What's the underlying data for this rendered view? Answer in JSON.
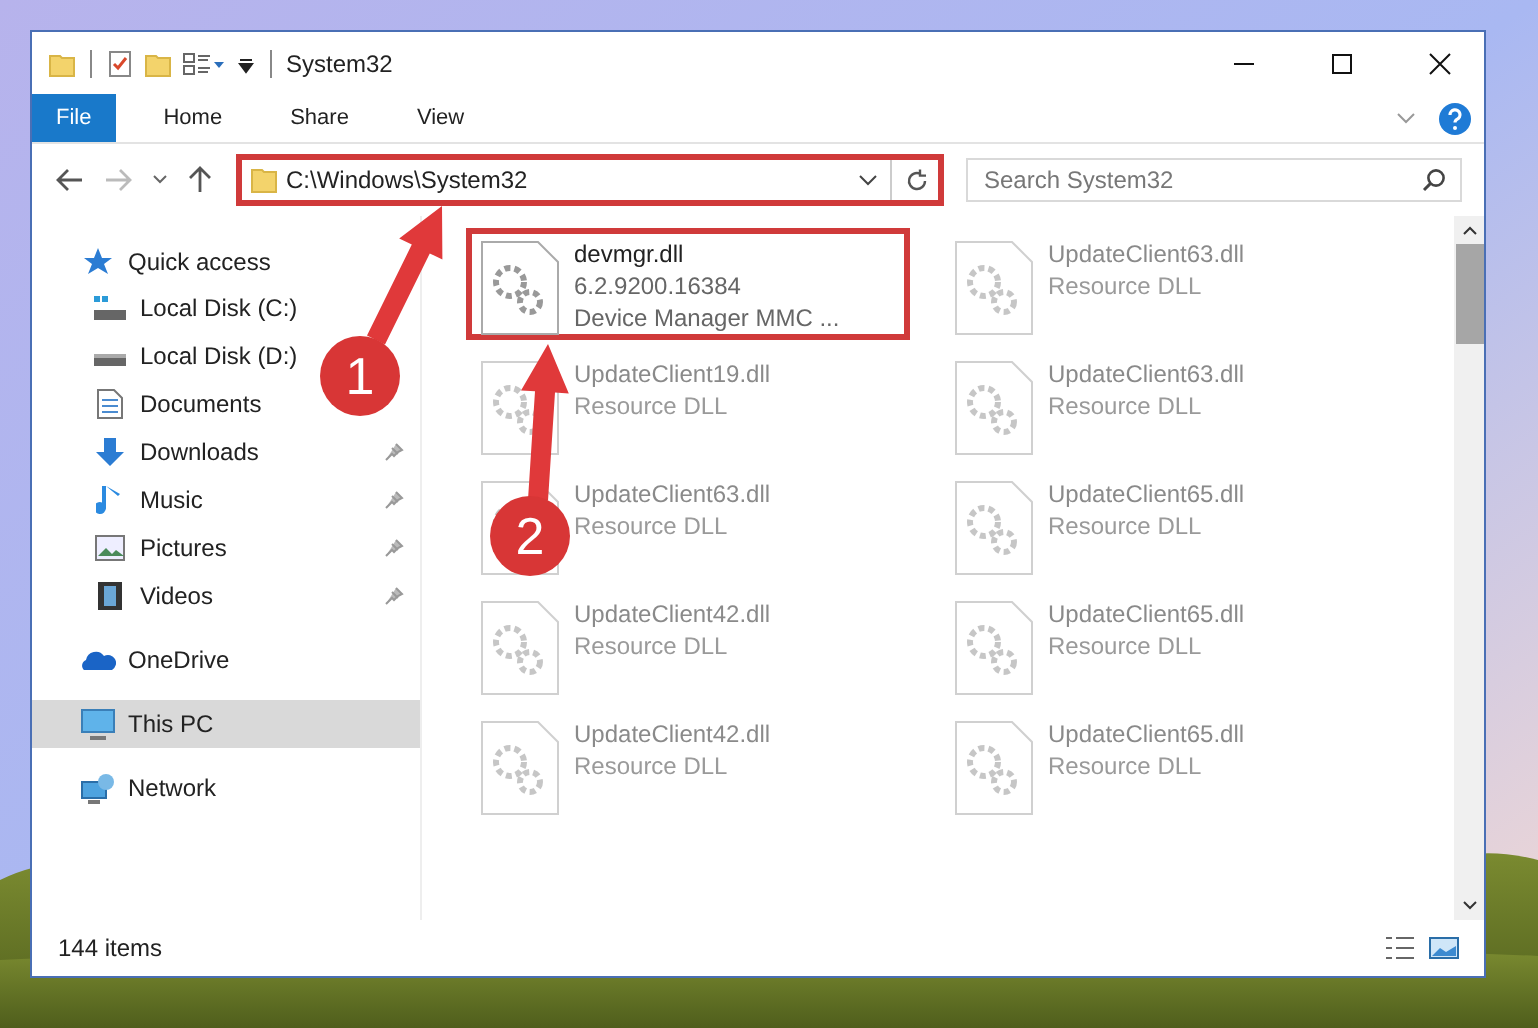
{
  "window": {
    "title": "System32"
  },
  "ribbon_tabs": [
    {
      "label": "File",
      "selected": true
    },
    {
      "label": "Home",
      "selected": false
    },
    {
      "label": "Share",
      "selected": false
    },
    {
      "label": "View",
      "selected": false
    }
  ],
  "address_bar": {
    "path": "C:\\Windows\\System32",
    "highlighted": true
  },
  "search": {
    "placeholder": "Search System32"
  },
  "nav": [
    {
      "label": "Quick access",
      "kind": "star",
      "selected": false,
      "children": [
        {
          "label": "Local Disk (C:)",
          "kind": "system-drive",
          "pinned": false,
          "selected": false
        },
        {
          "label": "Local Disk (D:)",
          "kind": "drive",
          "pinned": false,
          "selected": false
        },
        {
          "label": "Documents",
          "kind": "document",
          "pinned": false,
          "selected": false
        },
        {
          "label": "Downloads",
          "kind": "download",
          "pinned": true,
          "selected": false
        },
        {
          "label": "Music",
          "kind": "music",
          "pinned": true,
          "selected": false
        },
        {
          "label": "Pictures",
          "kind": "pictures",
          "pinned": true,
          "selected": false
        },
        {
          "label": "Videos",
          "kind": "video",
          "pinned": true,
          "selected": false
        }
      ]
    },
    {
      "label": "OneDrive",
      "kind": "cloud",
      "selected": false
    },
    {
      "label": "This PC",
      "kind": "monitor",
      "selected": true
    },
    {
      "label": "Network",
      "kind": "network",
      "selected": false
    }
  ],
  "files": [
    {
      "name": "devmgr.dll",
      "lines": [
        "6.2.9200.16384",
        "Device Manager MMC ..."
      ],
      "highlighted": true,
      "faded": false
    },
    {
      "name": "UpdateClient63.dll",
      "lines": [
        "Resource DLL"
      ],
      "highlighted": false,
      "faded": true
    },
    {
      "name": "UpdateClient19.dll",
      "lines": [
        "Resource DLL"
      ],
      "highlighted": false,
      "faded": true
    },
    {
      "name": "UpdateClient63.dll",
      "lines": [
        "Resource DLL"
      ],
      "highlighted": false,
      "faded": true
    },
    {
      "name": "UpdateClient63.dll",
      "lines": [
        "Resource DLL"
      ],
      "highlighted": false,
      "faded": true
    },
    {
      "name": "UpdateClient65.dll",
      "lines": [
        "Resource DLL"
      ],
      "highlighted": false,
      "faded": true
    },
    {
      "name": "UpdateClient42.dll",
      "lines": [
        "Resource DLL"
      ],
      "highlighted": false,
      "faded": true
    },
    {
      "name": "UpdateClient65.dll",
      "lines": [
        "Resource DLL"
      ],
      "highlighted": false,
      "faded": true
    },
    {
      "name": "UpdateClient42.dll",
      "lines": [
        "Resource DLL"
      ],
      "highlighted": false,
      "faded": true
    },
    {
      "name": "UpdateClient65.dll",
      "lines": [
        "Resource DLL"
      ],
      "highlighted": false,
      "faded": true
    }
  ],
  "annotations": [
    {
      "label": "1"
    },
    {
      "label": "2"
    }
  ],
  "status_bar": {
    "item_count": "144 items"
  }
}
